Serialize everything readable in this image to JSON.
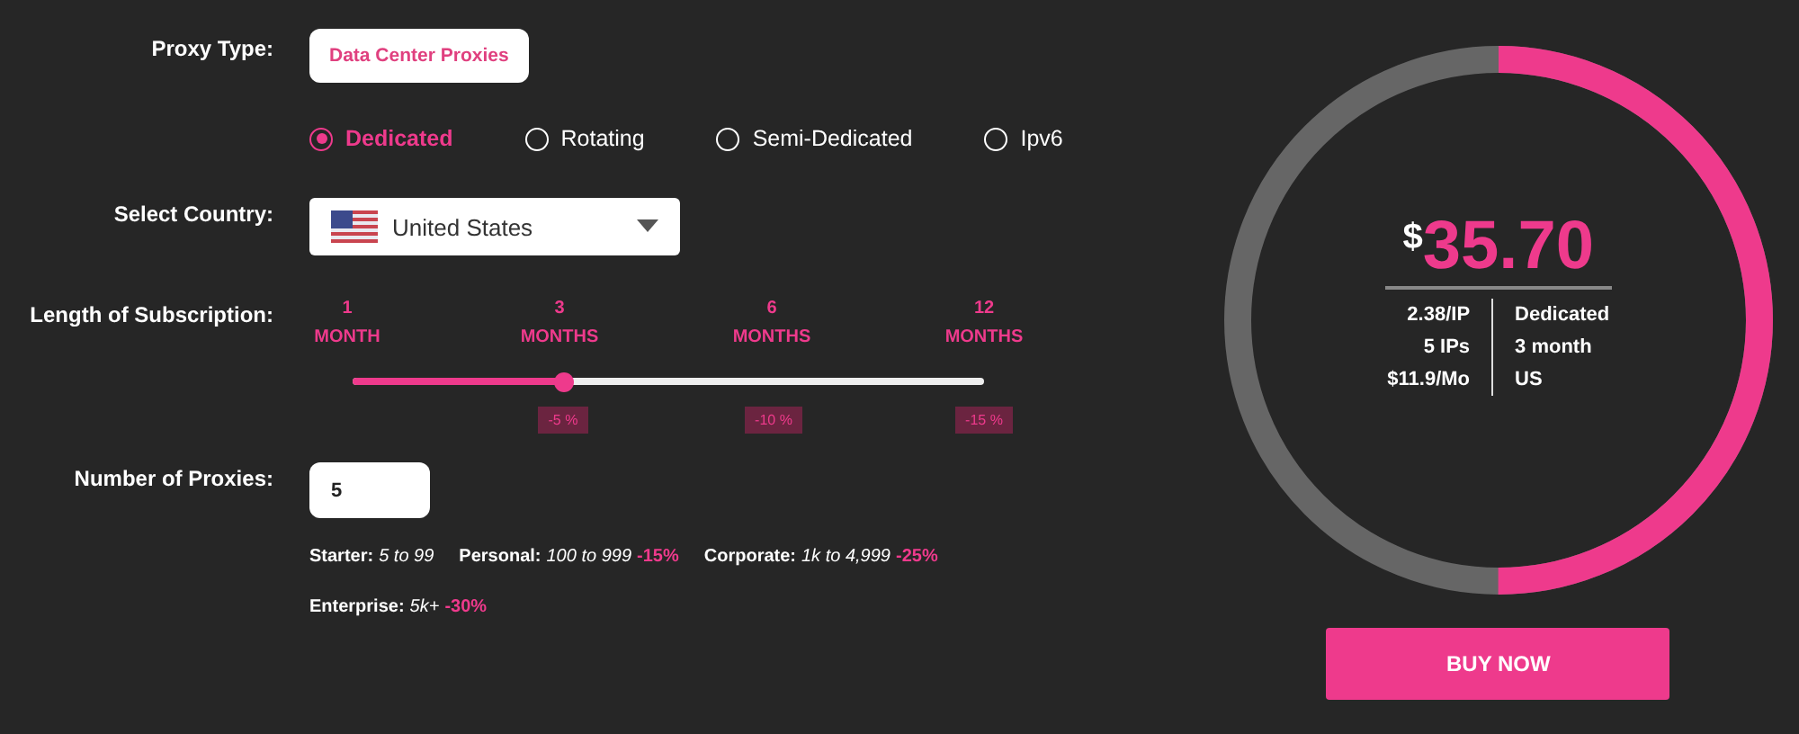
{
  "proxy_type": {
    "label": "Proxy Type:",
    "value": "Data Center Proxies"
  },
  "plans": [
    {
      "label": "Dedicated",
      "selected": true
    },
    {
      "label": "Rotating",
      "selected": false
    },
    {
      "label": "Semi-Dedicated",
      "selected": false
    },
    {
      "label": "Ipv6",
      "selected": false
    }
  ],
  "country": {
    "label": "Select Country:",
    "value": "United States"
  },
  "subscription": {
    "label": "Length of Subscription:",
    "level": 0.336,
    "options": [
      {
        "number": "1",
        "unit": "MONTH"
      },
      {
        "number": "3",
        "unit": "MONTHS",
        "discount": "-5 %"
      },
      {
        "number": "6",
        "unit": "MONTHS",
        "discount": "-10 %"
      },
      {
        "number": "12",
        "unit": "MONTHS",
        "discount": "-15 %"
      }
    ]
  },
  "proxies": {
    "label": "Number of Proxies:",
    "value": "5"
  },
  "tiers": [
    {
      "name": "Starter:",
      "range": "5 to 99"
    },
    {
      "name": "Personal:",
      "range": "100 to 999",
      "discount": "-15%"
    },
    {
      "name": "Corporate:",
      "range": "1k to 4,999",
      "discount": "-25%"
    },
    {
      "name": "Enterprise:",
      "range": "5k+",
      "discount": "-30%"
    }
  ],
  "summary": {
    "currency": "$",
    "price": "35.70",
    "left": [
      "2.38/IP",
      "5 IPs",
      "$11.9/Mo"
    ],
    "right": [
      "Dedicated",
      "3 month",
      "US"
    ]
  },
  "buy_button": "BUY NOW"
}
